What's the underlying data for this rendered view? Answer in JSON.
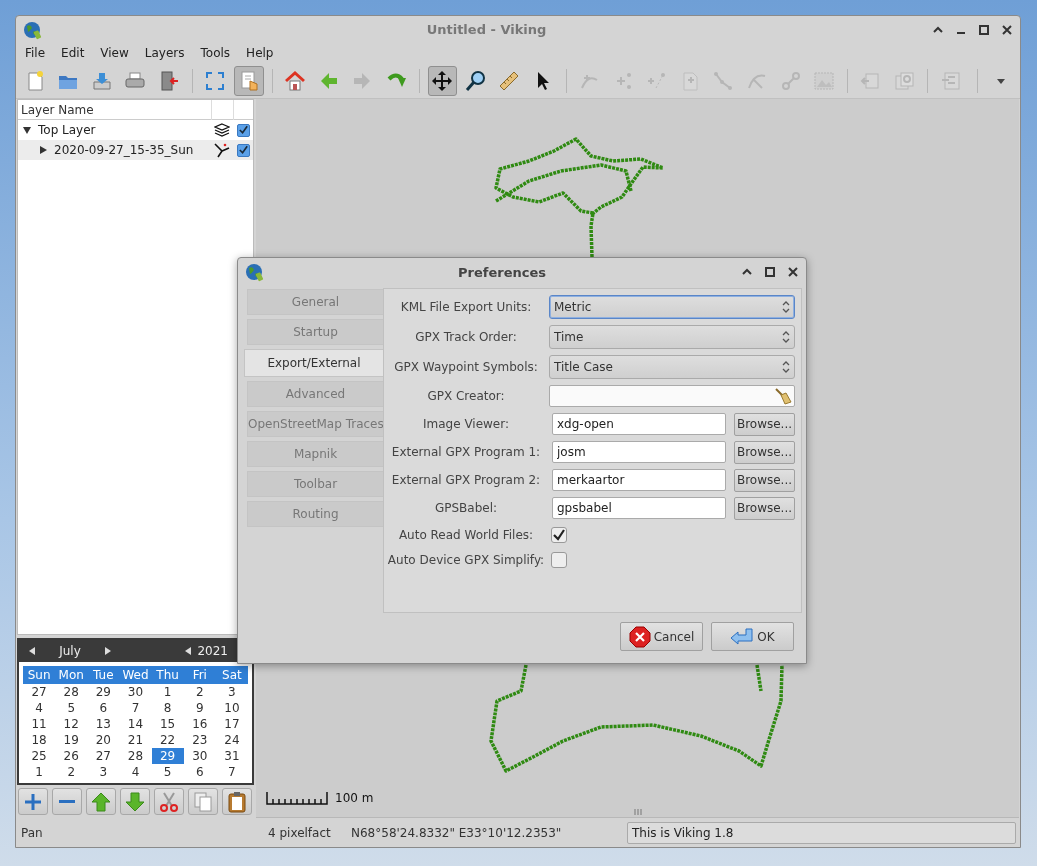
{
  "window": {
    "title": "Untitled - Viking"
  },
  "menu": [
    "File",
    "Edit",
    "View",
    "Layers",
    "Tools",
    "Help"
  ],
  "toolbar": {
    "groups": [
      [
        {
          "pressed": false,
          "disabled": false
        },
        {
          "pressed": false,
          "disabled": false
        },
        {
          "pressed": false,
          "disabled": false
        },
        {
          "pressed": false,
          "disabled": false
        },
        {
          "pressed": false,
          "disabled": false
        }
      ],
      [
        {
          "pressed": false,
          "disabled": false
        },
        {
          "pressed": true,
          "disabled": false
        }
      ],
      [
        {
          "pressed": false,
          "disabled": false
        },
        {
          "pressed": false,
          "disabled": false
        },
        {
          "pressed": false,
          "disabled": true
        },
        {
          "pressed": false,
          "disabled": false
        }
      ],
      [
        {
          "pressed": true,
          "disabled": false
        },
        {
          "pressed": false,
          "disabled": false
        },
        {
          "pressed": false,
          "disabled": false
        },
        {
          "pressed": false,
          "disabled": false
        }
      ],
      [
        {
          "pressed": false,
          "disabled": true
        },
        {
          "pressed": false,
          "disabled": true
        },
        {
          "pressed": false,
          "disabled": true
        },
        {
          "pressed": false,
          "disabled": true
        },
        {
          "pressed": false,
          "disabled": true
        },
        {
          "pressed": false,
          "disabled": true
        },
        {
          "pressed": false,
          "disabled": true
        },
        {
          "pressed": false,
          "disabled": true
        }
      ],
      [
        {
          "pressed": false,
          "disabled": true
        },
        {
          "pressed": false,
          "disabled": true
        }
      ],
      [
        {
          "pressed": false,
          "disabled": true
        }
      ]
    ]
  },
  "layers": {
    "columns": [
      "Layer Name"
    ],
    "rows": [
      {
        "name": "Top Layer",
        "expanded": true,
        "visible": true,
        "children": [
          {
            "name": "2020-09-27_15-35_Sun",
            "expanded": false,
            "visible": true
          }
        ]
      }
    ]
  },
  "calendar": {
    "month": "July",
    "year": "2021",
    "weekdays": [
      "Sun",
      "Mon",
      "Tue",
      "Wed",
      "Thu",
      "Fri",
      "Sat"
    ],
    "weeks": [
      [
        {
          "day": "27",
          "selected": false
        },
        {
          "day": "28",
          "selected": false
        },
        {
          "day": "29",
          "selected": false
        },
        {
          "day": "30",
          "selected": false
        },
        {
          "day": "1",
          "selected": false
        },
        {
          "day": "2",
          "selected": false
        },
        {
          "day": "3",
          "selected": false
        }
      ],
      [
        {
          "day": "4",
          "selected": false
        },
        {
          "day": "5",
          "selected": false
        },
        {
          "day": "6",
          "selected": false
        },
        {
          "day": "7",
          "selected": false
        },
        {
          "day": "8",
          "selected": false
        },
        {
          "day": "9",
          "selected": false
        },
        {
          "day": "10",
          "selected": false
        }
      ],
      [
        {
          "day": "11",
          "selected": false
        },
        {
          "day": "12",
          "selected": false
        },
        {
          "day": "13",
          "selected": false
        },
        {
          "day": "14",
          "selected": false
        },
        {
          "day": "15",
          "selected": false
        },
        {
          "day": "16",
          "selected": false
        },
        {
          "day": "17",
          "selected": false
        }
      ],
      [
        {
          "day": "18",
          "selected": false
        },
        {
          "day": "19",
          "selected": false
        },
        {
          "day": "20",
          "selected": false
        },
        {
          "day": "21",
          "selected": false
        },
        {
          "day": "22",
          "selected": false
        },
        {
          "day": "23",
          "selected": false
        },
        {
          "day": "24",
          "selected": false
        }
      ],
      [
        {
          "day": "25",
          "selected": false
        },
        {
          "day": "26",
          "selected": false
        },
        {
          "day": "27",
          "selected": false
        },
        {
          "day": "28",
          "selected": false
        },
        {
          "day": "29",
          "selected": true
        },
        {
          "day": "30",
          "selected": false
        },
        {
          "day": "31",
          "selected": false
        }
      ],
      [
        {
          "day": "1",
          "selected": false
        },
        {
          "day": "2",
          "selected": false
        },
        {
          "day": "3",
          "selected": false
        },
        {
          "day": "4",
          "selected": false
        },
        {
          "day": "5",
          "selected": false
        },
        {
          "day": "6",
          "selected": false
        },
        {
          "day": "7",
          "selected": false
        }
      ]
    ]
  },
  "map": {
    "scale": "100 m"
  },
  "status_bar": {
    "mode": "Pan",
    "zoom": "4 pixelfact",
    "position": "N68°58'24.8332\" E33°10'12.2353\"",
    "message": "This is Viking 1.8"
  },
  "dialog": {
    "title": "Preferences",
    "tabs": [
      {
        "label": "General",
        "selected": false
      },
      {
        "label": "Startup",
        "selected": false
      },
      {
        "label": "Export/External",
        "selected": true
      },
      {
        "label": "Advanced",
        "selected": false
      },
      {
        "label": "OpenStreetMap Traces",
        "selected": false
      },
      {
        "label": "Mapnik",
        "selected": false
      },
      {
        "label": "Toolbar",
        "selected": false
      },
      {
        "label": "Routing",
        "selected": false
      }
    ],
    "fields": [
      {
        "kind": "combo",
        "label": "KML File Export Units:",
        "value": "Metric",
        "focused": true
      },
      {
        "kind": "combo",
        "label": "GPX Track Order:",
        "value": "Time",
        "focused": false
      },
      {
        "kind": "combo",
        "label": "GPX Waypoint Symbols:",
        "value": "Title Case",
        "focused": false
      },
      {
        "kind": "clear-entry",
        "label": "GPX Creator:"
      },
      {
        "kind": "browse-entry",
        "label": "Image Viewer:",
        "value": "xdg-open",
        "button": "Browse..."
      },
      {
        "kind": "browse-entry",
        "label": "External GPX Program 1:",
        "value": "josm",
        "button": "Browse..."
      },
      {
        "kind": "browse-entry",
        "label": "External GPX Program 2:",
        "value": "merkaartor",
        "button": "Browse..."
      },
      {
        "kind": "browse-entry",
        "label": "GPSBabel:",
        "value": "gpsbabel",
        "button": "Browse..."
      },
      {
        "kind": "checkbox",
        "label": "Auto Read World Files:",
        "checked": true
      },
      {
        "kind": "checkbox",
        "label": "Auto Device GPX Simplify:",
        "checked": false
      }
    ],
    "buttons": [
      {
        "kind": "cancel",
        "label": "Cancel"
      },
      {
        "kind": "ok",
        "label": "OK"
      }
    ]
  }
}
